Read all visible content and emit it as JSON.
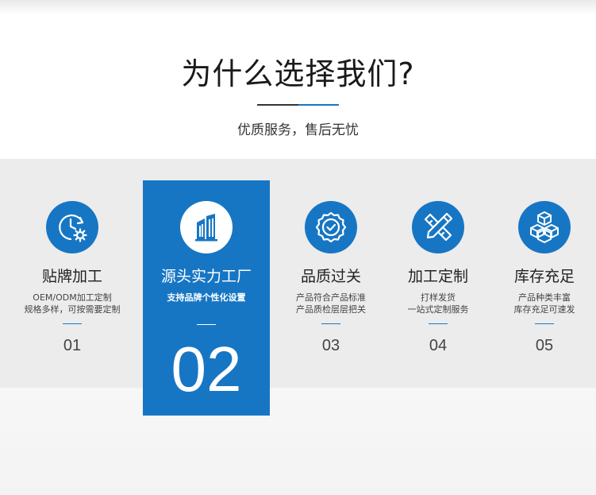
{
  "header": {
    "title": "为什么选择我们?",
    "subtitle": "优质服务，售后无忧"
  },
  "colors": {
    "accent": "#1776c4",
    "band": "#ececec"
  },
  "features": [
    {
      "icon": "gear-clock-icon",
      "name": "贴牌加工",
      "desc_line1": "OEM/ODM加工定制",
      "desc_line2": "规格多样，可按需要定制",
      "number": "01"
    },
    {
      "icon": "factory-building-icon",
      "name": "源头实力工厂",
      "desc_line1": "支持品牌个性化设置",
      "number": "02",
      "active": true
    },
    {
      "icon": "quality-badge-icon",
      "name": "品质过关",
      "desc_line1": "产品符合产品标准",
      "desc_line2": "产品质检层层把关",
      "number": "03"
    },
    {
      "icon": "ruler-pencil-icon",
      "name": "加工定制",
      "desc_line1": "打样发货",
      "desc_line2": "一站式定制服务",
      "number": "04"
    },
    {
      "icon": "boxes-icon",
      "name": "库存充足",
      "desc_line1": "产品种类丰富",
      "desc_line2": "库存充足可速发",
      "number": "05"
    }
  ]
}
